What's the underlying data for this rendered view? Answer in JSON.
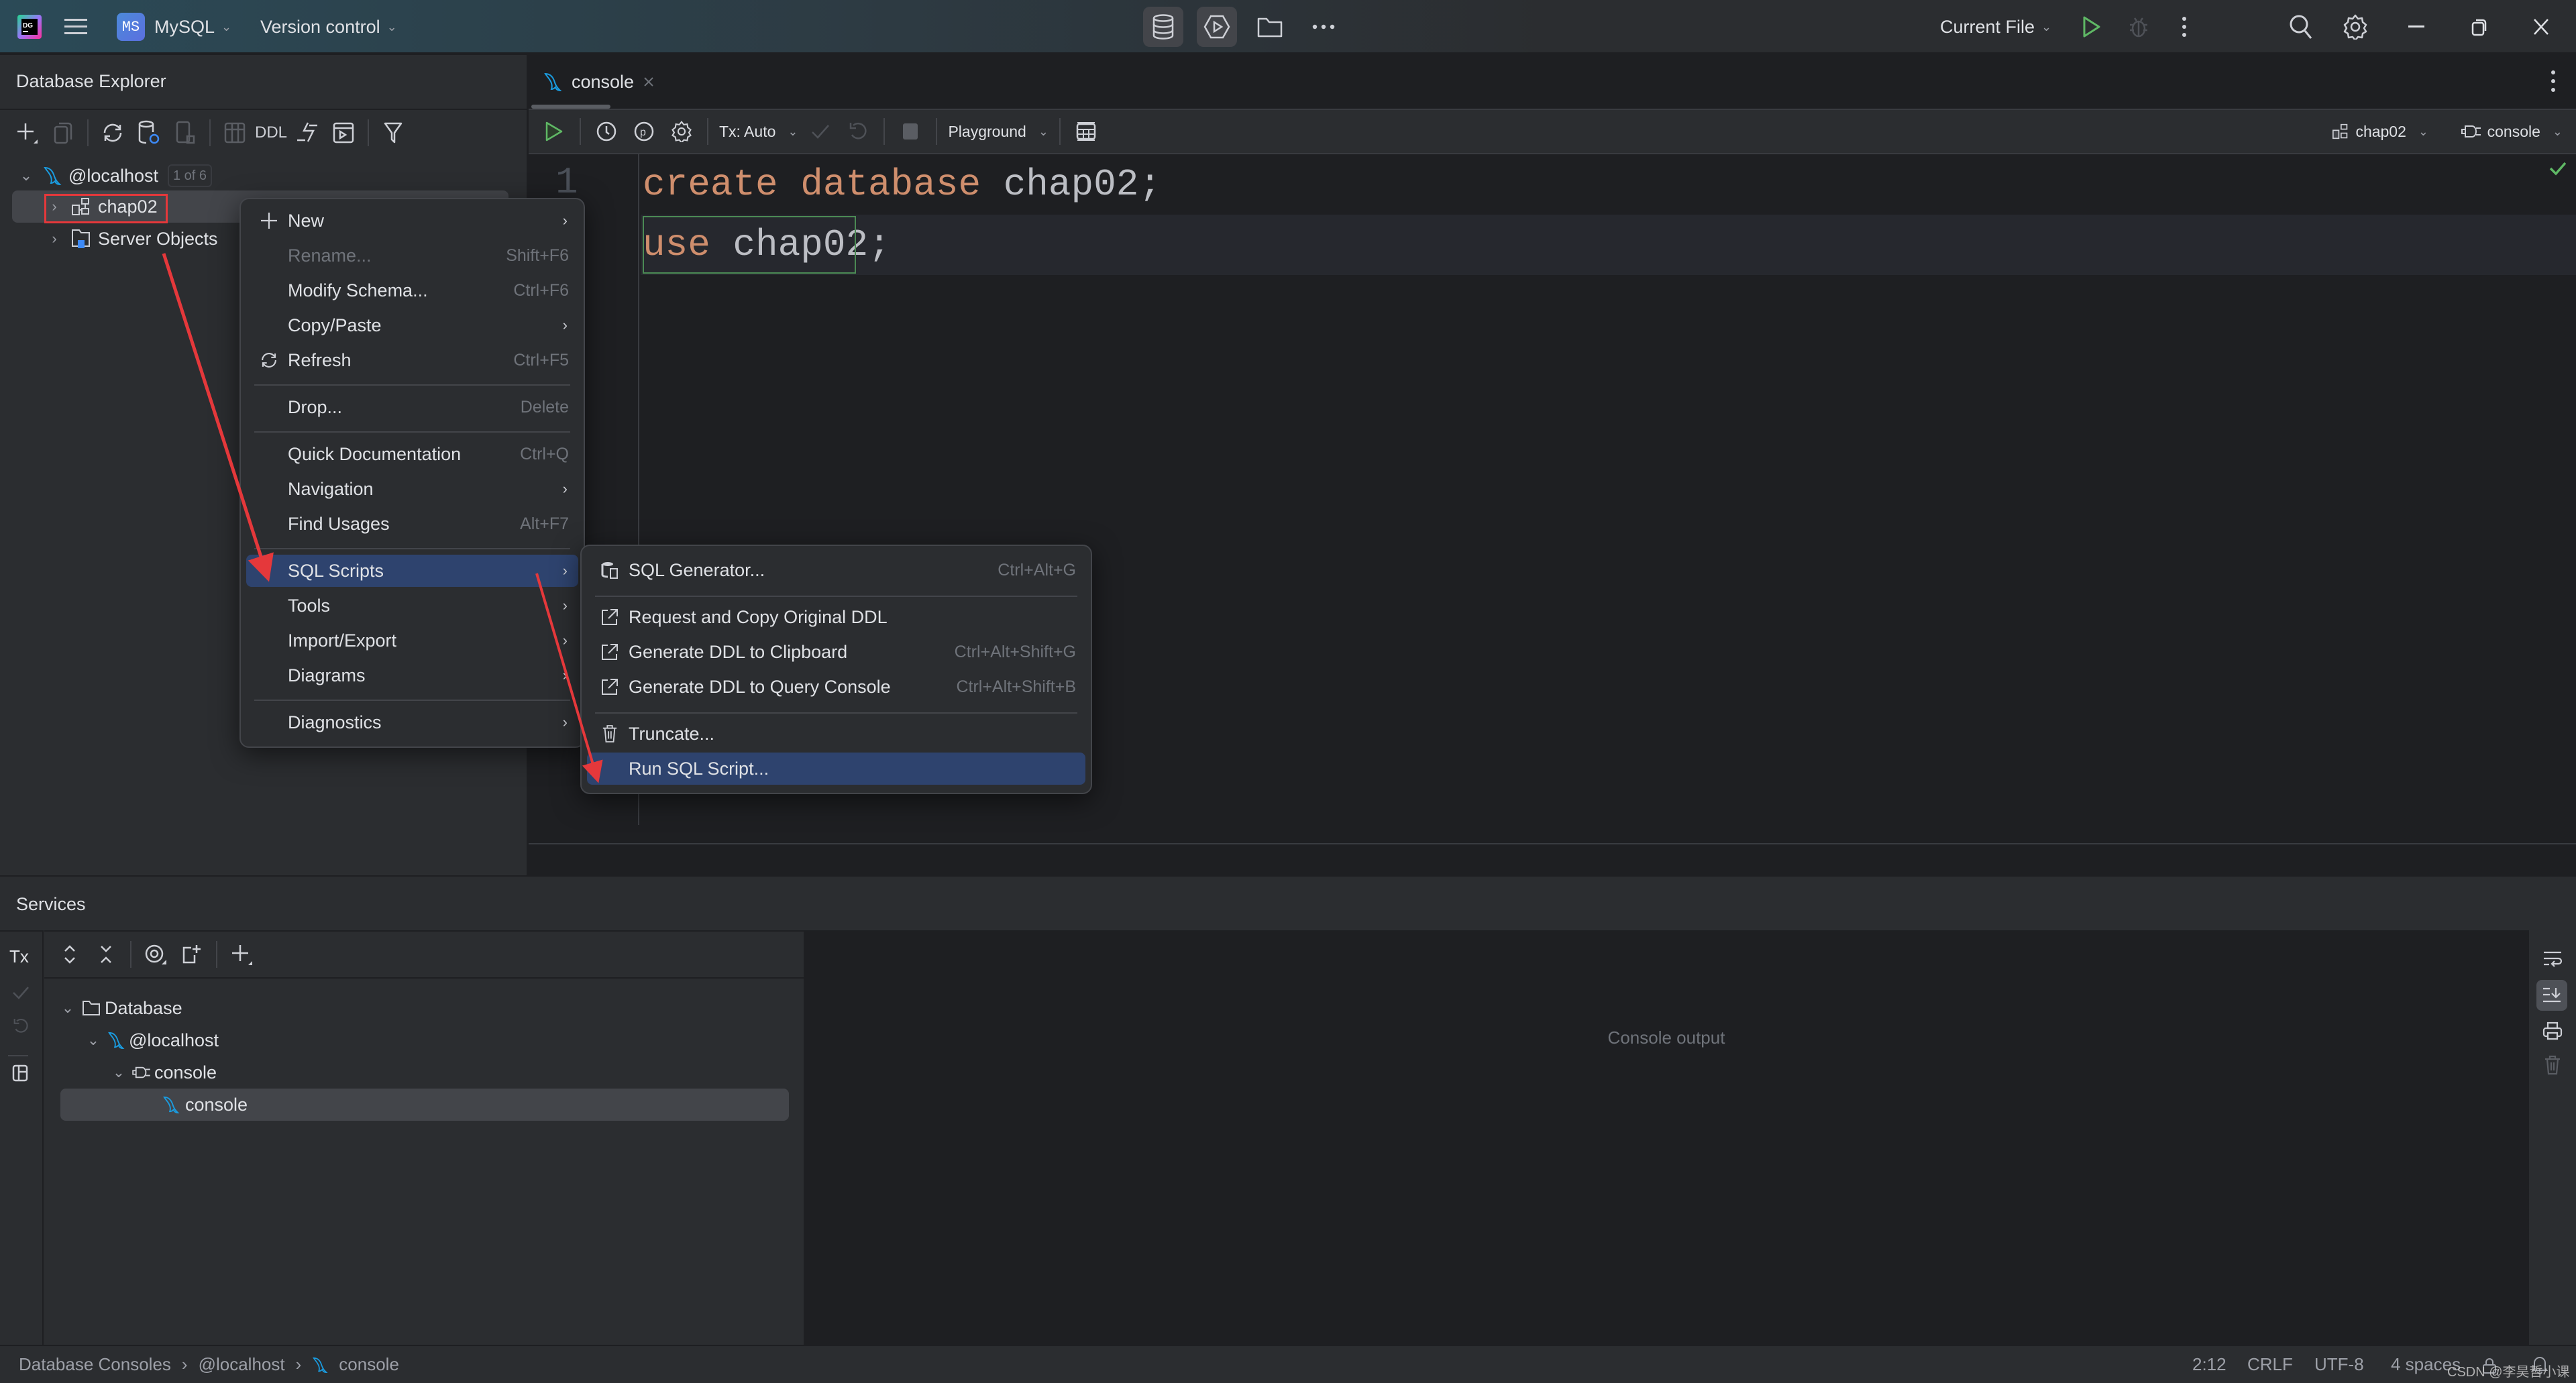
{
  "titlebar": {
    "project_badge": "MS",
    "project_name": "MySQL",
    "vcs_label": "Version control",
    "run_config": "Current File",
    "icons": [
      "app-logo-icon",
      "hamburger-menu-icon",
      "database-icon",
      "services-icon",
      "folder-icon",
      "more-horizontal-icon",
      "run-icon",
      "debug-icon",
      "more-vertical-icon",
      "search-icon",
      "settings-gear-icon",
      "minimize-icon",
      "restore-icon",
      "close-icon"
    ]
  },
  "explorer": {
    "title": "Database Explorer",
    "toolbar": {
      "ddl_label": "DDL"
    },
    "tree": [
      {
        "label": "@localhost",
        "badge": "1 of 6",
        "expanded": true,
        "icon": "mysql-dolphin-icon"
      },
      {
        "label": "chap02",
        "expanded": false,
        "selected": true,
        "icon": "schema-icon"
      },
      {
        "label": "Server Objects",
        "expanded": false,
        "icon": "server-objects-folder-icon"
      }
    ]
  },
  "editor": {
    "tab": {
      "label": "console"
    },
    "toolbar": {
      "tx_label": "Tx: Auto",
      "playground_label": "Playground",
      "schema_selector": "chap02",
      "session_selector": "console"
    },
    "lines": [
      {
        "number": "1",
        "tokens": [
          {
            "text": "create database ",
            "type": "keyword"
          },
          {
            "text": "chap02;",
            "type": "identifier"
          }
        ]
      },
      {
        "number": "",
        "tokens": [
          {
            "text": "use ",
            "type": "keyword"
          },
          {
            "text": "chap02;",
            "type": "identifier"
          }
        ]
      }
    ]
  },
  "context_menu": {
    "items": [
      {
        "label": "New",
        "icon": "plus-icon",
        "submenu": true
      },
      {
        "label": "Rename...",
        "shortcut": "Shift+F6",
        "disabled": true
      },
      {
        "label": "Modify Schema...",
        "shortcut": "Ctrl+F6"
      },
      {
        "label": "Copy/Paste",
        "submenu": true
      },
      {
        "label": "Refresh",
        "shortcut": "Ctrl+F5",
        "icon": "refresh-icon"
      },
      {
        "label": "Drop...",
        "shortcut": "Delete"
      },
      {
        "label": "Quick Documentation",
        "shortcut": "Ctrl+Q"
      },
      {
        "label": "Navigation",
        "submenu": true
      },
      {
        "label": "Find Usages",
        "shortcut": "Alt+F7"
      },
      {
        "label": "SQL Scripts",
        "submenu": true,
        "selected": true
      },
      {
        "label": "Tools",
        "submenu": true
      },
      {
        "label": "Import/Export",
        "submenu": true
      },
      {
        "label": "Diagrams",
        "submenu": true
      },
      {
        "label": "Diagnostics",
        "submenu": true
      }
    ]
  },
  "submenu": {
    "items": [
      {
        "label": "SQL Generator...",
        "shortcut": "Ctrl+Alt+G",
        "icon": "sql-generator-icon"
      },
      {
        "label": "Request and Copy Original DDL",
        "shortcut": "",
        "icon": "external-link-icon"
      },
      {
        "label": "Generate DDL to Clipboard",
        "shortcut": "Ctrl+Alt+Shift+G",
        "icon": "external-link-icon"
      },
      {
        "label": "Generate DDL to Query Console",
        "shortcut": "Ctrl+Alt+Shift+B",
        "icon": "external-link-icon"
      },
      {
        "label": "Truncate...",
        "icon": "trash-icon"
      },
      {
        "label": "Run SQL Script...",
        "selected": true
      }
    ]
  },
  "services": {
    "title": "Services",
    "tree": [
      {
        "label": "Database",
        "icon": "folder-icon",
        "expanded": true
      },
      {
        "label": "@localhost",
        "icon": "mysql-dolphin-icon",
        "expanded": true
      },
      {
        "label": "console",
        "icon": "session-plug-icon",
        "expanded": true
      },
      {
        "label": "console",
        "icon": "mysql-dolphin-icon",
        "selected": true
      }
    ],
    "output_placeholder": "Console output",
    "tx_label": "Tx"
  },
  "statusbar": {
    "breadcrumbs": [
      "Database Consoles",
      "@localhost",
      "console"
    ],
    "caret_position": "2:12",
    "line_separator": "CRLF",
    "encoding": "UTF-8",
    "indent": "4 spaces",
    "watermark": "CSDN @李昊哲小课"
  },
  "colors": {
    "selection": "#2e436e",
    "keyword": "#cf8e6d",
    "identifier": "#bcbec4",
    "annotation": "#e5383b",
    "run_green": "#5fb865"
  }
}
